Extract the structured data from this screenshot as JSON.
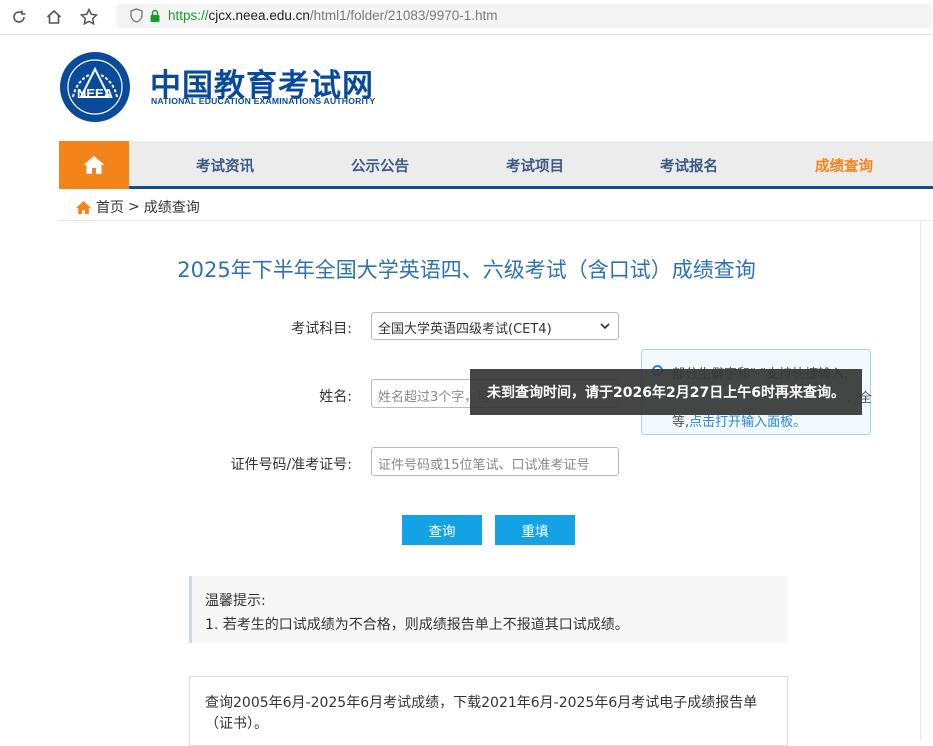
{
  "browser": {
    "url_protocol": "https://",
    "url_host": "cjcx.neea.edu.cn",
    "url_path": "/html1/folder/21083/9970-1.htm"
  },
  "header": {
    "logo_text_cn": "中国教育考试网",
    "logo_text_en": "NATIONAL EDUCATION EXAMINATIONS AUTHORITY",
    "logo_emblem_text": "NEEA"
  },
  "nav": {
    "items": [
      {
        "label": "考试资讯"
      },
      {
        "label": "公示公告"
      },
      {
        "label": "考试项目"
      },
      {
        "label": "考试报名"
      },
      {
        "label": "成绩查询"
      }
    ],
    "accent_color": "#f48319",
    "brand_color": "#0c4e9a"
  },
  "breadcrumb": {
    "home": "首页",
    "separator": ">",
    "current": "成绩查询"
  },
  "form": {
    "title": "2025年下半年全国大学英语四、六级考试（含口试）成绩查询",
    "subject_label": "考试科目:",
    "subject_value": "全国大学英语四级考试(CET4)",
    "name_label": "姓名:",
    "name_placeholder": "姓名超过3个字，可",
    "id_label": "证件号码/准考证号:",
    "id_placeholder": "证件号码或15位笔试、口试准考证号",
    "query_button": "查询",
    "reset_button": "重填"
  },
  "input_tip": {
    "line1": "部分生僻字和\"·\"支持快捷输入,",
    "line2_end": "、全",
    "line3_prefix": "等,",
    "line3_link": "点击打开输入面板。"
  },
  "toast": {
    "message": "未到查询时间，请于2026年2月27日上午6时再来查询。"
  },
  "notice": {
    "title": "温馨提示:",
    "item1": "1. 若考生的口试成绩为不合格，则成绩报告单上不报道其口试成绩。"
  },
  "info": {
    "text": "查询2005年6月-2025年6月考试成绩，下载2021年6月-2025年6月考试电子成绩报告单（证书）。"
  }
}
